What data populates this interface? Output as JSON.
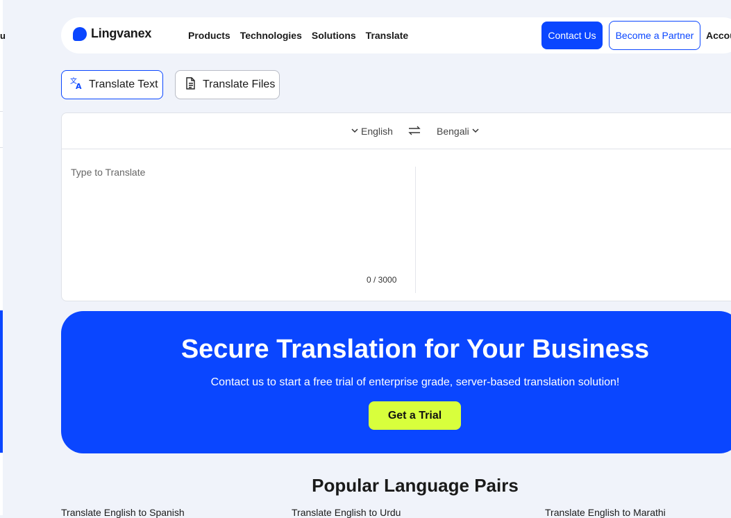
{
  "sidebar": {
    "fragment": "u"
  },
  "header": {
    "logo": "Lingvanex",
    "nav": [
      "Products",
      "Technologies",
      "Solutions",
      "Translate"
    ],
    "contact_label": "Contact Us",
    "partner_label": "Become a Partner",
    "account_label": "Accou"
  },
  "mode_tabs": {
    "text_label": "Translate Text",
    "files_label": "Translate Files",
    "active": "Translate Text"
  },
  "translator": {
    "source_lang": "English",
    "target_lang": "Bengali",
    "placeholder": "Type to Translate",
    "counter": "0 / 3000"
  },
  "promo": {
    "title": "Secure Translation for Your Business",
    "subtitle": "Contact us to start a free trial of enterprise grade, server-based translation solution!",
    "cta": "Get a Trial"
  },
  "popular": {
    "title": "Popular Language Pairs",
    "pairs": [
      "Translate English to Spanish",
      "Translate English to Urdu",
      "Translate English to Marathi"
    ]
  },
  "colors": {
    "brand_blue": "#0a46ff",
    "cta_lime": "#d8ff3c",
    "background": "#f0f3fa"
  }
}
